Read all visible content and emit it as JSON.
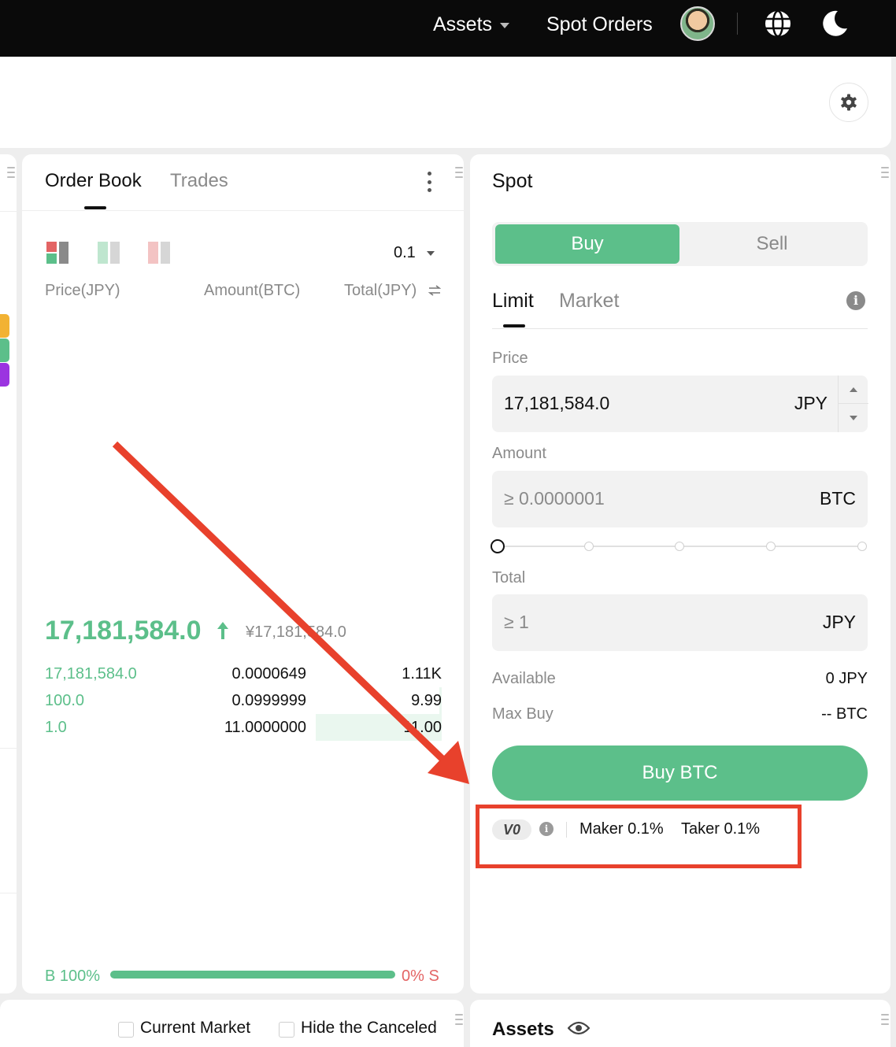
{
  "nav": {
    "assets_label": "Assets",
    "spot_orders_label": "Spot Orders"
  },
  "order_book": {
    "tab_active": "Order Book",
    "tab_inactive": "Trades",
    "precision": "0.1",
    "columns": [
      "Price(JPY)",
      "Amount(BTC)",
      "Total(JPY)"
    ],
    "last_price": "17,181,584.0",
    "last_price_fiat": "¥17,181,584.0",
    "bids": [
      {
        "price": "17,181,584.0",
        "amount": "0.0000649",
        "total": "1.11K",
        "depth": 0
      },
      {
        "price": "100.0",
        "amount": "0.0999999",
        "total": "9.99",
        "depth": 0.005
      },
      {
        "price": "1.0",
        "amount": "11.0000000",
        "total": "11.00",
        "depth": 0.3
      }
    ],
    "buy_ratio_label": "B 100%",
    "sell_ratio_label": "0% S",
    "buy_ratio": 1.0
  },
  "spot": {
    "title": "Spot",
    "buy_tab": "Buy",
    "sell_tab": "Sell",
    "type_limit": "Limit",
    "type_market": "Market",
    "price_label": "Price",
    "price_value": "17,181,584.0",
    "price_unit": "JPY",
    "amount_label": "Amount",
    "amount_placeholder": "≥ 0.0000001",
    "amount_unit": "BTC",
    "slider_value": 0,
    "total_label": "Total",
    "total_placeholder": "≥ 1",
    "total_unit": "JPY",
    "available_label": "Available",
    "available_value": "0 JPY",
    "max_buy_label": "Max Buy",
    "max_buy_value": "-- BTC",
    "buy_button": "Buy BTC",
    "vip_level": "V0",
    "maker_fee": "Maker 0.1%",
    "taker_fee": "Taker 0.1%"
  },
  "filters": {
    "current_market": "Current Market",
    "hide_canceled": "Hide the Canceled"
  },
  "assets_panel": {
    "title": "Assets"
  },
  "colors": {
    "buy_green": "#5cbf8a",
    "sell_red": "#e36464",
    "annotation_red": "#e8412c",
    "nav_bg": "#0a0a0a"
  }
}
